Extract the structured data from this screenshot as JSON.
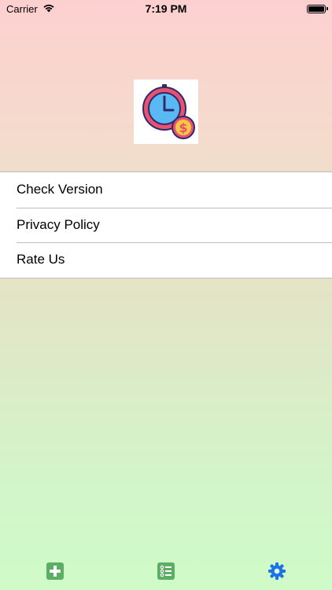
{
  "status_bar": {
    "carrier": "Carrier",
    "time": "7:19 PM",
    "icons": [
      "wifi-icon",
      "battery-icon"
    ]
  },
  "logo": {
    "icon": "clock-dollar-icon",
    "colors": {
      "ring": "#e8516f",
      "face": "#5ab8f3",
      "coin": "#f7c844",
      "dollar": "#e8516f"
    }
  },
  "menu": {
    "items": [
      {
        "label": "Check Version"
      },
      {
        "label": "Privacy Policy"
      },
      {
        "label": "Rate Us"
      }
    ]
  },
  "tab_bar": {
    "tabs": [
      {
        "icon": "add-icon",
        "color": "#5dae65"
      },
      {
        "icon": "list-icon",
        "color": "#5dae65"
      },
      {
        "icon": "gear-icon",
        "color": "#1a73e8"
      }
    ]
  }
}
